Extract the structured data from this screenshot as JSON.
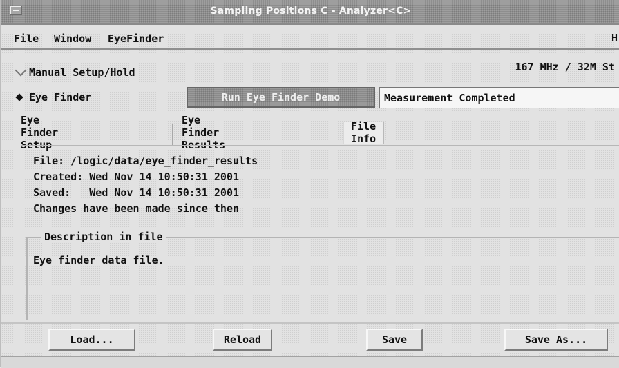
{
  "window": {
    "title": "Sampling Positions C - Analyzer<C>"
  },
  "menubar": {
    "items": [
      "File",
      "Window",
      "EyeFinder"
    ],
    "help_hint": "H"
  },
  "mode": {
    "manual_label": "Manual Setup/Hold",
    "eye_finder_label": "Eye Finder",
    "selected": "Eye Finder",
    "status_right": "167 MHz / 32M St"
  },
  "run": {
    "button_label": "Run Eye Finder Demo",
    "status_text": "Measurement Completed"
  },
  "tabs": [
    {
      "label": "Eye Finder Setup",
      "active": false
    },
    {
      "label": "Eye Finder Results",
      "active": false
    },
    {
      "label": "File Info",
      "active": true
    }
  ],
  "file_info": {
    "file_line": "File: /logic/data/eye_finder_results",
    "created_line": "Created: Wed Nov 14 10:50:31 2001",
    "saved_line": "Saved:   Wed Nov 14 10:50:31 2001",
    "changes_line": "Changes have been made since then"
  },
  "description": {
    "legend": "Description in file",
    "text": "Eye finder data file."
  },
  "buttons": {
    "load": "Load...",
    "reload": "Reload",
    "save": "Save",
    "save_as": "Save As..."
  }
}
